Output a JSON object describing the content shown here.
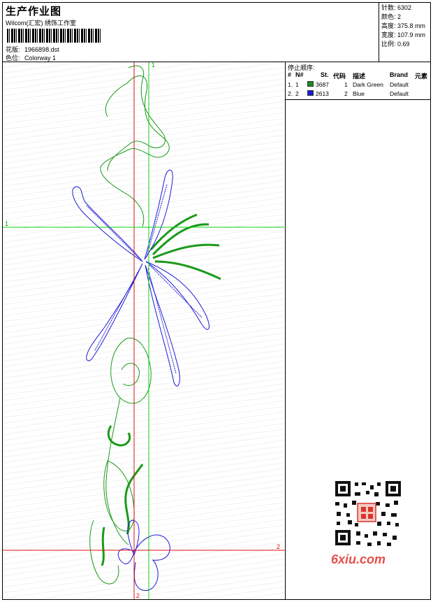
{
  "header": {
    "title": "生产作业图",
    "subtitle": "Wilcom(汇宏) 绣饰工作室",
    "design_label": "花版:",
    "design_value": "1966898.dst",
    "colorway_label": "色位:",
    "colorway_value": "Colorway 1"
  },
  "stats": [
    {
      "label": "针数:",
      "value": "6302"
    },
    {
      "label": "颜色:",
      "value": "2"
    },
    {
      "label": "高度:",
      "value": "375.8 mm"
    },
    {
      "label": "宽度:",
      "value": "107.9 mm"
    },
    {
      "label": "比例:",
      "value": "0.69"
    }
  ],
  "stop_sequence": {
    "title": "停止顺序:",
    "headers": {
      "index": "#",
      "number": "N#",
      "stitch": "St.",
      "code": "代码",
      "description": "描述",
      "brand": "Brand",
      "element": "元素"
    },
    "rows": [
      {
        "index": "1.",
        "number": "1",
        "color": "#1a8c1a",
        "stitch": "3687",
        "code": "1",
        "description": "Dark Green",
        "brand": "Default"
      },
      {
        "index": "2.",
        "number": "2",
        "color": "#1a1ad9",
        "stitch": "2613",
        "code": "2",
        "description": "Blue",
        "brand": "Default"
      }
    ]
  },
  "guides": {
    "v1": "1",
    "h1": "1",
    "h2": "2",
    "v2": "2"
  },
  "watermark": "6xiu.com"
}
